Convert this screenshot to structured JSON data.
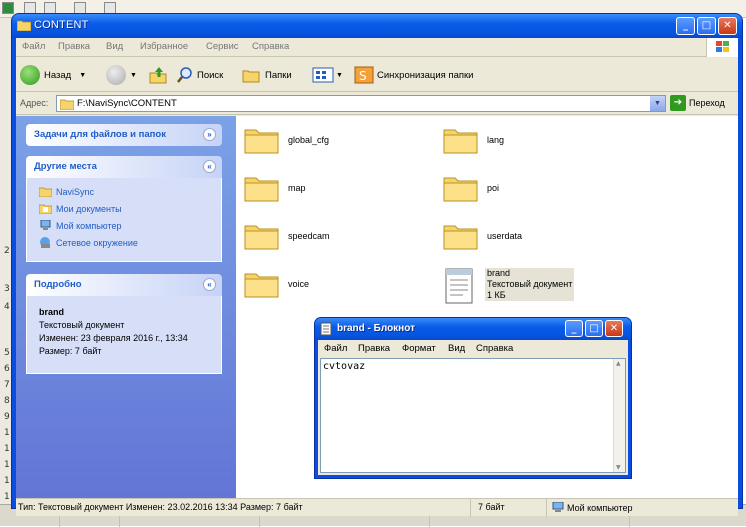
{
  "explorer": {
    "title": "CONTENT",
    "menu": [
      "Файл",
      "Правка",
      "Вид",
      "Избранное",
      "Сервис",
      "Справка"
    ],
    "toolbar": {
      "back": "Назад",
      "search": "Поиск",
      "folders": "Папки",
      "sync": "Синхронизация папки"
    },
    "address": {
      "label": "Адрес:",
      "value": "F:\\NaviSync\\CONTENT",
      "go": "Переход"
    },
    "tasks": {
      "file_tasks_title": "Задачи для файлов и папок",
      "other_places_title": "Другие места",
      "other_places": [
        "NaviSync",
        "Мои документы",
        "Мой компьютер",
        "Сетевое окружение"
      ],
      "details_title": "Подробно",
      "details": {
        "name": "brand",
        "type": "Текстовый документ",
        "modified": "Изменен: 23 февраля 2016 г., 13:34",
        "size": "Размер: 7 байт"
      }
    },
    "items": [
      {
        "name": "global_cfg"
      },
      {
        "name": "lang"
      },
      {
        "name": "map"
      },
      {
        "name": "poi"
      },
      {
        "name": "speedcam"
      },
      {
        "name": "userdata"
      },
      {
        "name": "voice"
      },
      {
        "name": "brand",
        "subtitle": "Текстовый документ",
        "size": "1 КБ"
      }
    ],
    "statusbar": {
      "info": "Тип: Текстовый документ Изменен: 23.02.2016 13:34 Размер: 7 байт",
      "size": "7 байт",
      "location": "Мой компьютер"
    }
  },
  "notepad": {
    "title": "brand - Блокнот",
    "menu": [
      "Файл",
      "Правка",
      "Формат",
      "Вид",
      "Справка"
    ],
    "content": "cvtovaz"
  },
  "colors": {
    "title_blue": "#0a5ce8",
    "task_pane": "#7ba2e7",
    "link_blue": "#215dc6",
    "folder_yellow": "#f7d46b"
  }
}
